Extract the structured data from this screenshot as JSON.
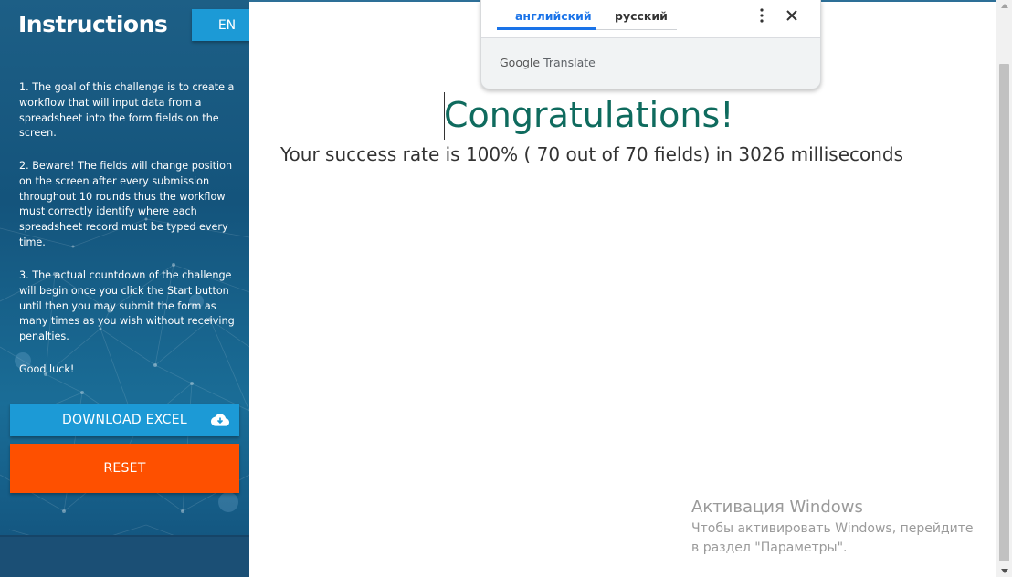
{
  "sidebar": {
    "title": "Instructions",
    "language_button": "EN",
    "paragraphs": [
      "1. The goal of this challenge is to create a workflow that will input data from a spreadsheet into the form fields on the screen.",
      "2. Beware! The fields will change position on the screen after every submission throughout 10 rounds thus the workflow must correctly identify where each spreadsheet record must be typed every time.",
      "3. The actual countdown of the challenge will begin once you click the Start button until then you may submit the form as many times as you wish without receiving penalties.",
      "Good luck!"
    ],
    "download_label": "DOWNLOAD EXCEL",
    "download_icon": "cloud-download-icon",
    "reset_label": "RESET",
    "colors": {
      "download": "#1c9ad6",
      "reset": "#fe5000",
      "sidebar": "#14547c"
    }
  },
  "main": {
    "heading": "Congratulations!",
    "result": "Your success rate is 100% ( 70 out of 70 fields) in 3026 milliseconds",
    "heading_color": "#0f6b5e"
  },
  "translate_popup": {
    "tabs": [
      "английский",
      "русский"
    ],
    "active_tab": "английский",
    "menu_icon": "more-vert-icon",
    "close_icon": "close-icon",
    "brand_google": "Google",
    "brand_translate": "Translate"
  },
  "windows_watermark": {
    "title": "Активация Windows",
    "text": "Чтобы активировать Windows, перейдите в раздел \"Параметры\"."
  }
}
